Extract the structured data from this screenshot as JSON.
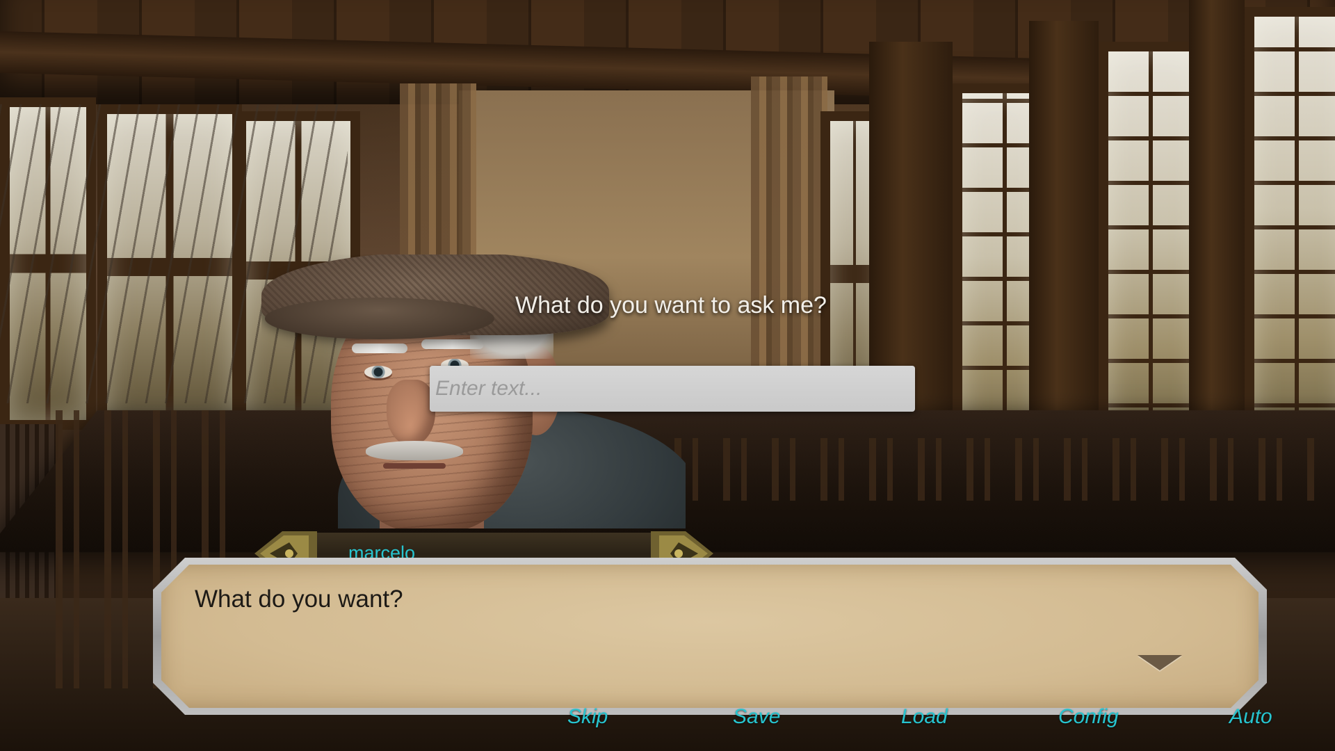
{
  "prompt": {
    "question": "What do you want to ask me?",
    "input_value": "",
    "input_placeholder": "Enter text..."
  },
  "dialogue": {
    "speaker": "marcelo",
    "text": "What do you want?"
  },
  "menu": {
    "items": [
      {
        "label": "Skip"
      },
      {
        "label": "Save"
      },
      {
        "label": "Load"
      },
      {
        "label": "Config"
      },
      {
        "label": "Auto"
      }
    ]
  },
  "colors": {
    "accent": "#27c4cf",
    "dialog_parchment": "#d3bb92",
    "nameplate_dark": "#2a2216",
    "nameplate_gold": "#8c7a3c"
  },
  "icons": {
    "advance": "triangle-down-icon",
    "nameplate_ornament": "ornament-icon"
  }
}
